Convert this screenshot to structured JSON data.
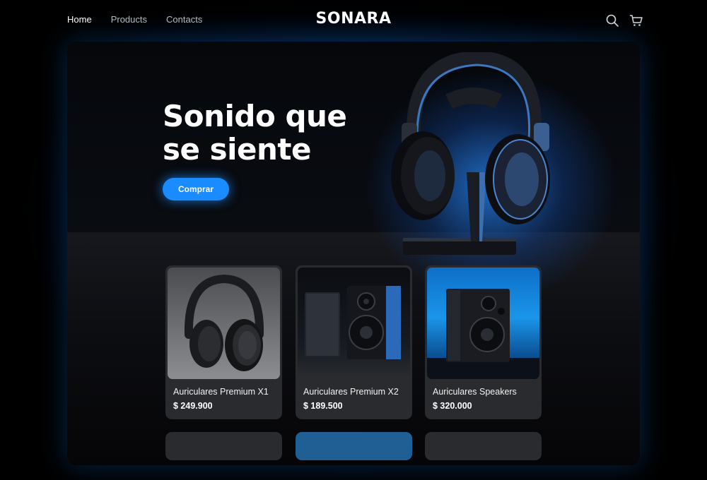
{
  "nav": {
    "items": [
      {
        "label": "Home",
        "active": true
      },
      {
        "label": "Products",
        "active": false
      },
      {
        "label": "Contacts",
        "active": false
      }
    ]
  },
  "brand": "SONARA",
  "header_icons": [
    "search-icon",
    "cart-icon"
  ],
  "hero": {
    "title_line1": "Sonido que",
    "title_line2": "se siente",
    "cta_label": "Comprar"
  },
  "products": [
    {
      "name": "Auriculares Premium X1",
      "price": "$ 249.900"
    },
    {
      "name": "Auriculares Premium X2",
      "price": "$ 189.500"
    },
    {
      "name": "Auriculares Speakers",
      "price": "$ 320.000"
    }
  ],
  "colors": {
    "accent": "#1a8cff",
    "background": "#000000",
    "card": "#2a2b2e"
  }
}
